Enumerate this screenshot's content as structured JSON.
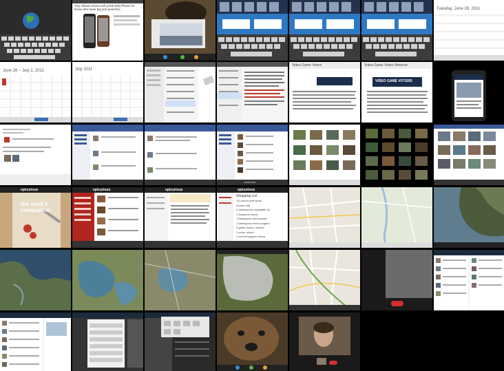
{
  "contact_sheet_title": "",
  "thumbnails": {
    "r1c2_headline": "Tiny Vibram shoes sell (US$ 250) Phone for those who have big and powerful...",
    "r1c7_date": "Tuesday, June 28, 2011",
    "r2c1_range": "June 26 – July 2, 2011",
    "r2c2_month": "July 2011",
    "r2c5_title": "Video Game Voters",
    "r2c6_title": "Video Game Voters Network",
    "r2c7_banner": "VIDEO GAME VOTERS",
    "r3c4_tab": "facebook",
    "r4c1_app": "epicurious",
    "r4c1_hero": "the cook's companion",
    "r4c2_app": "epicurious",
    "r4c3_app": "epicurious",
    "r4c4_app": "epicurious",
    "r4c4_list_title": "Shopping List",
    "r4c4_items": [
      "1/2 pound skirt steak",
      "Kosher salt",
      "2 tablespoons vegetable oil",
      "1 teaspoon cumin",
      "1 tablespoon chili powder",
      "1 tablespoon fresh oregano",
      "4 garlic cloves, minced",
      "1 onion, sliced",
      "1 red bell pepper, sliced"
    ]
  },
  "colors": {
    "background": "#000000",
    "accent_blue": "#3b5998",
    "epicurious_red": "#b0251d",
    "map_green": "#d9ead3"
  },
  "icons": [
    "globe-icon",
    "end-call-icon",
    "keyboard-icon"
  ]
}
